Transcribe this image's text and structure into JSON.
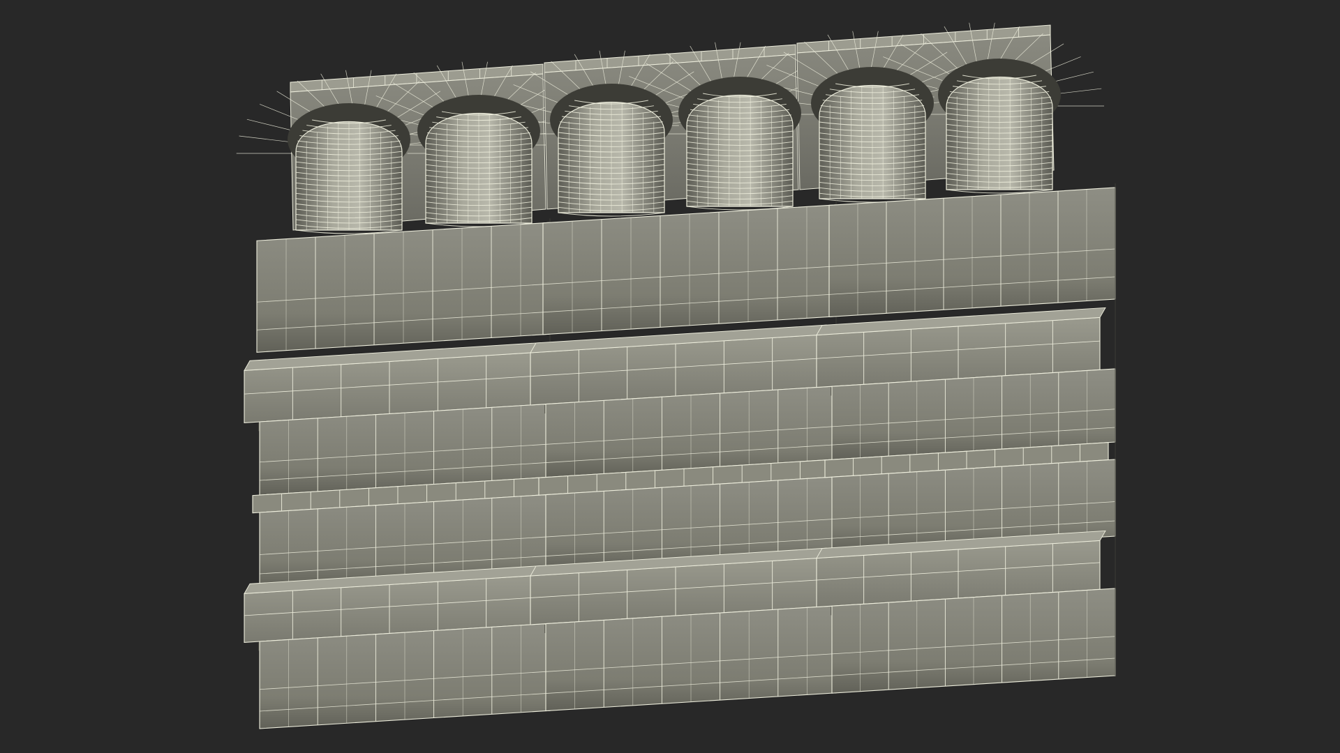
{
  "scene": {
    "subject": "wireframe-3d-model",
    "colors": {
      "background": "#282828",
      "surface_light": "#8c8c80",
      "surface_mid": "#7a7a6e",
      "surface_dark": "#5e5e54",
      "surface_shadow": "#4a4a42",
      "cylinder_light": "#b5b5a8",
      "cylinder_dark": "#6c6c62",
      "wire": "#eeeedd",
      "edge_dark": "#3a3a34"
    },
    "counts": {
      "packs": 3,
      "cylinders_per_pack": 2,
      "front_rows": 7
    }
  }
}
